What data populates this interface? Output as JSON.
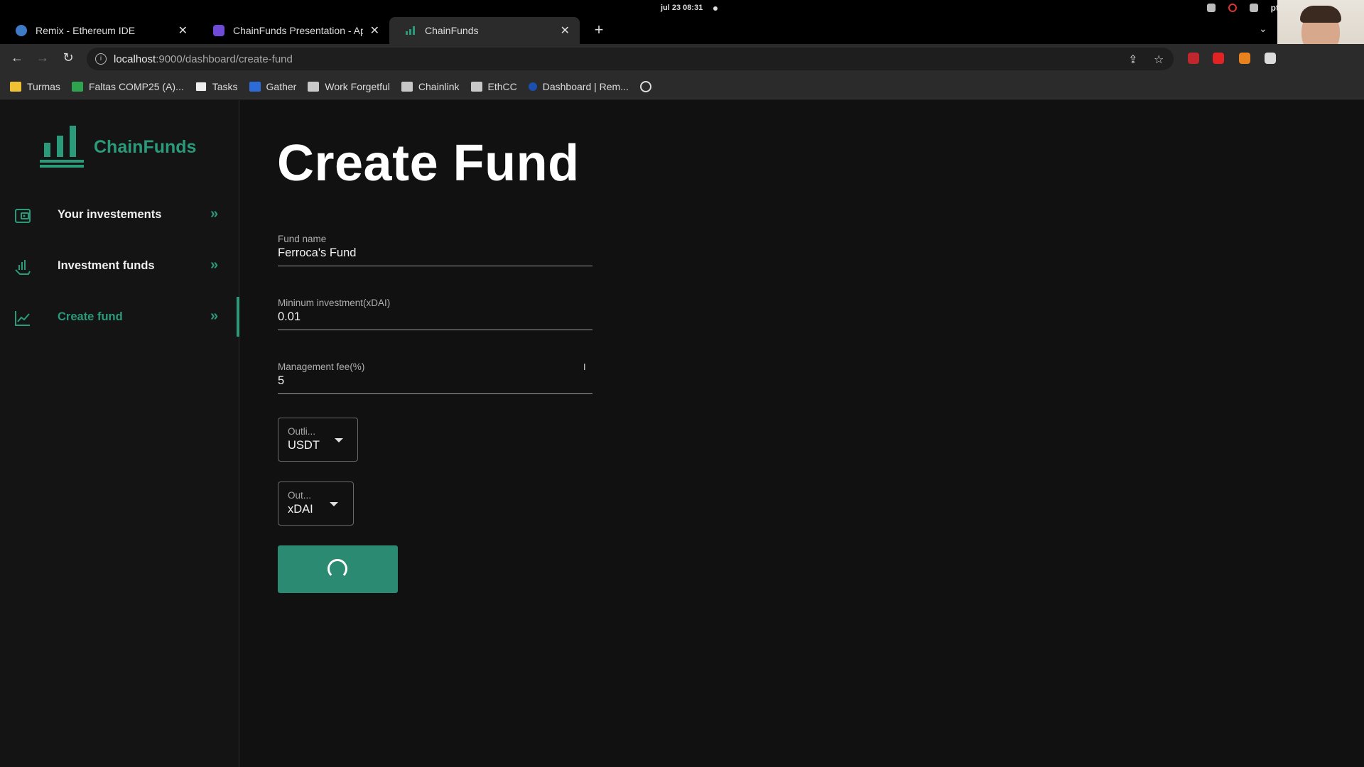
{
  "os": {
    "clock": "jul 23  08:31",
    "lang": "pt"
  },
  "browser": {
    "tabs": [
      {
        "title": "Remix - Ethereum IDE",
        "favicon_color": "#3e7bc7"
      },
      {
        "title": "ChainFunds Presentation - Ap",
        "favicon_color": "#6f4bd8"
      },
      {
        "title": "ChainFunds",
        "favicon_color": "#2b9a7a"
      }
    ],
    "url_host": "localhost",
    "url_rest": ":9000/dashboard/create-fund",
    "bookmarks": [
      {
        "label": "Turmas",
        "icon": "classroom-icon"
      },
      {
        "label": "Faltas COMP25 (A)...",
        "icon": "sheets-icon"
      },
      {
        "label": "Tasks",
        "icon": "notion-icon"
      },
      {
        "label": "Gather",
        "icon": "gather-icon"
      },
      {
        "label": "Work Forgetful",
        "icon": "folder-icon"
      },
      {
        "label": "Chainlink",
        "icon": "folder-icon"
      },
      {
        "label": "EthCC",
        "icon": "folder-icon"
      },
      {
        "label": "Dashboard | Rem...",
        "icon": "remix-icon"
      }
    ]
  },
  "app": {
    "brand": "ChainFunds",
    "accent": "#2b9a7a",
    "nav": [
      {
        "label": "Your investements",
        "icon": "wallet-icon"
      },
      {
        "label": "Investment funds",
        "icon": "hand-chart-icon"
      },
      {
        "label": "Create fund",
        "icon": "line-chart-icon",
        "active": true
      }
    ],
    "page_title": "Create Fund",
    "form": {
      "fund_name": {
        "label": "Fund name",
        "value": "Ferroca's Fund"
      },
      "min_investment": {
        "label": "Mininum investment(xDAI)",
        "value": "0.01"
      },
      "management_fee": {
        "label": "Management fee(%)",
        "value": "5"
      },
      "select1": {
        "label": "Outli...",
        "value": "USDT"
      },
      "select2": {
        "label": "Out...",
        "value": "xDAI"
      },
      "submit_state": "loading"
    }
  }
}
